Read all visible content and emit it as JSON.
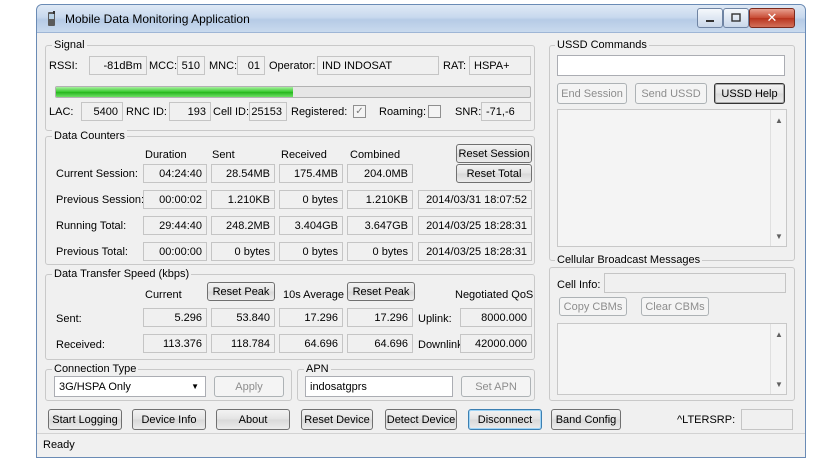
{
  "window": {
    "title": "Mobile Data Monitoring Application",
    "status": "Ready"
  },
  "signal": {
    "group_label": "Signal",
    "rssi_label": "RSSI:",
    "rssi": "-81dBm",
    "mcc_label": "MCC:",
    "mcc": "510",
    "mnc_label": "MNC:",
    "mnc": "01",
    "operator_label": "Operator:",
    "operator": "IND INDOSAT",
    "rat_label": "RAT:",
    "rat": "HSPA+",
    "strength_fraction": 0.5,
    "lac_label": "LAC:",
    "lac": "5400",
    "rnc_label": "RNC ID:",
    "rnc": "193",
    "cell_label": "Cell ID:",
    "cell": "25153",
    "registered_label": "Registered:",
    "registered": true,
    "roaming_label": "Roaming:",
    "roaming": false,
    "snr_label": "SNR:",
    "snr": "-71,-6"
  },
  "counters": {
    "group_label": "Data Counters",
    "columns": [
      "Duration",
      "Sent",
      "Received",
      "Combined"
    ],
    "reset_session": "Reset Session",
    "reset_total": "Reset Total",
    "rows": [
      {
        "label": "Current Session:",
        "duration": "04:24:40",
        "sent": "28.54MB",
        "received": "175.4MB",
        "combined": "204.0MB",
        "date": ""
      },
      {
        "label": "Previous Session:",
        "duration": "00:00:02",
        "sent": "1.210KB",
        "received": "0 bytes",
        "combined": "1.210KB",
        "date": "2014/03/31 18:07:52"
      },
      {
        "label": "Running Total:",
        "duration": "29:44:40",
        "sent": "248.2MB",
        "received": "3.404GB",
        "combined": "3.647GB",
        "date": "2014/03/25 18:28:31"
      },
      {
        "label": "Previous Total:",
        "duration": "00:00:00",
        "sent": "0 bytes",
        "received": "0 bytes",
        "combined": "0 bytes",
        "date": "2014/03/25 18:28:31"
      }
    ]
  },
  "speed": {
    "group_label": "Data Transfer Speed (kbps)",
    "current_label": "Current",
    "reset_peak_1": "Reset Peak",
    "avg_label": "10s Average",
    "reset_peak_2": "Reset Peak",
    "qos_label": "Negotiated QoS",
    "sent_label": "Sent:",
    "received_label": "Received:",
    "sent_current": "5.296",
    "sent_peak": "53.840",
    "sent_avg": "17.296",
    "sent_peak_avg": "17.296",
    "uplink_label": "Uplink:",
    "uplink": "8000.000",
    "recv_current": "113.376",
    "recv_peak": "118.784",
    "recv_avg": "64.696",
    "recv_peak_avg": "64.696",
    "downlink_label": "Downlink:",
    "downlink": "42000.000"
  },
  "connection": {
    "type_label": "Connection Type",
    "type_value": "3G/HSPA Only",
    "apply": "Apply",
    "apn_label": "APN",
    "apn_value": "indosatgprs",
    "set_apn": "Set APN"
  },
  "bottom_buttons": {
    "start_logging": "Start Logging",
    "device_info": "Device Info",
    "about": "About",
    "reset_device": "Reset Device",
    "detect_device": "Detect Device",
    "disconnect": "Disconnect",
    "band_config": "Band Config",
    "lterstrp_label": "^LTERSRP:",
    "lterstrp_value": ""
  },
  "ussd": {
    "group_label": "USSD Commands",
    "input_value": "",
    "end_session": "End Session",
    "send_ussd": "Send USSD",
    "ussd_help": "USSD Help"
  },
  "cbm": {
    "group_label": "Cellular Broadcast Messages",
    "cell_info_label": "Cell Info:",
    "cell_info_value": "",
    "copy": "Copy CBMs",
    "clear": "Clear CBMs"
  },
  "colors": {
    "progress_green": "#2ebf24",
    "window_border": "#6a8bb5",
    "close_red": "#c74a33"
  }
}
